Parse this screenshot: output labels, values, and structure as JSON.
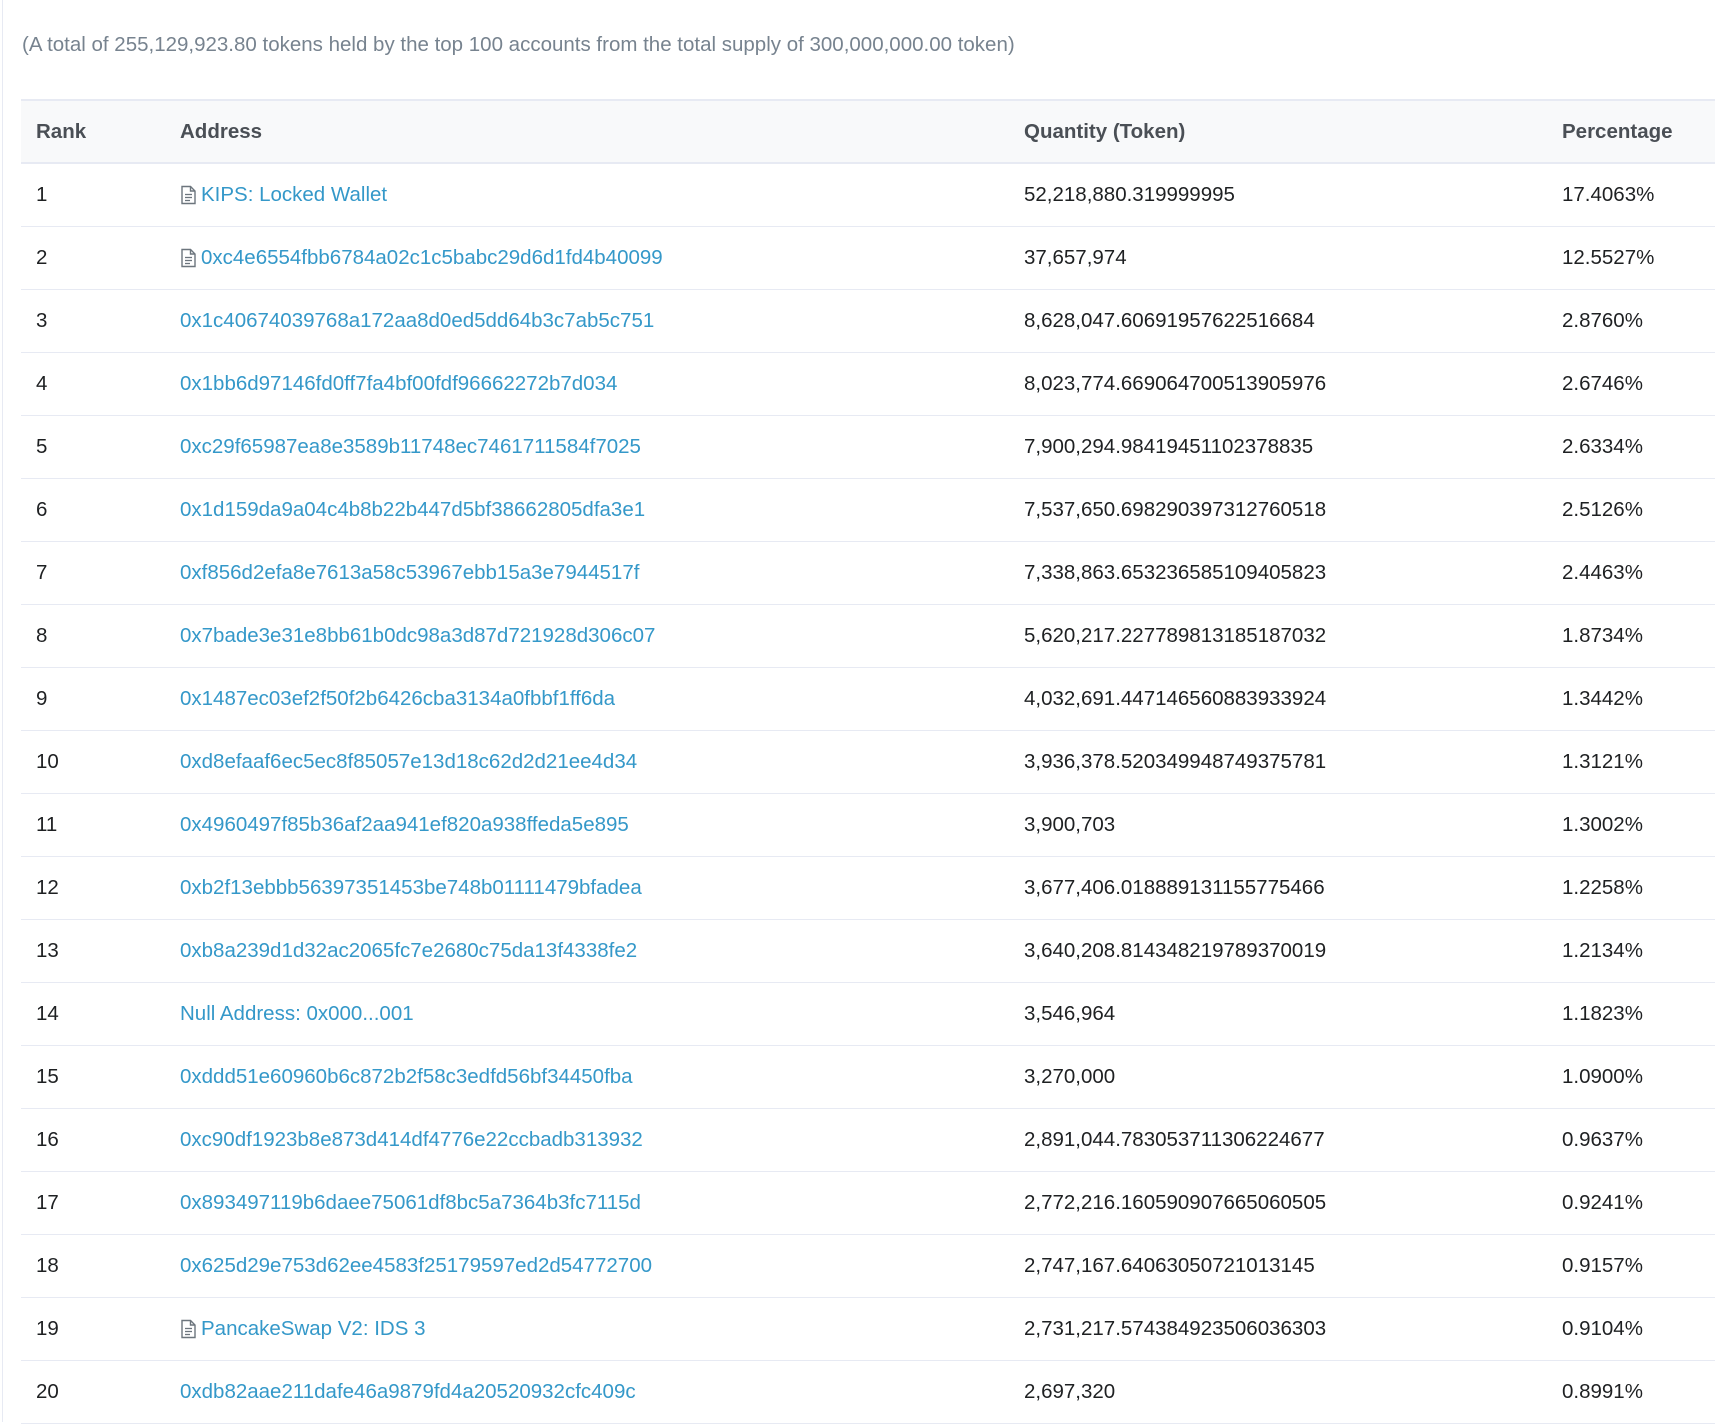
{
  "summary": "(A total of 255,129,923.80 tokens held by the top 100 accounts from the total supply of 300,000,000.00 token)",
  "table": {
    "headers": {
      "rank": "Rank",
      "address": "Address",
      "quantity": "Quantity (Token)",
      "percentage": "Percentage"
    },
    "icon": "contract-document-icon",
    "link_color": "#3498c9",
    "rows": [
      {
        "rank": "1",
        "address": "KIPS: Locked Wallet",
        "contract": true,
        "quantity": "52,218,880.319999995",
        "percentage": "17.4063%"
      },
      {
        "rank": "2",
        "address": "0xc4e6554fbb6784a02c1c5babc29d6d1fd4b40099",
        "contract": true,
        "quantity": "37,657,974",
        "percentage": "12.5527%"
      },
      {
        "rank": "3",
        "address": "0x1c40674039768a172aa8d0ed5dd64b3c7ab5c751",
        "contract": false,
        "quantity": "8,628,047.60691957622516684",
        "percentage": "2.8760%"
      },
      {
        "rank": "4",
        "address": "0x1bb6d97146fd0ff7fa4bf00fdf96662272b7d034",
        "contract": false,
        "quantity": "8,023,774.669064700513905976",
        "percentage": "2.6746%"
      },
      {
        "rank": "5",
        "address": "0xc29f65987ea8e3589b11748ec7461711584f7025",
        "contract": false,
        "quantity": "7,900,294.98419451102378835",
        "percentage": "2.6334%"
      },
      {
        "rank": "6",
        "address": "0x1d159da9a04c4b8b22b447d5bf38662805dfa3e1",
        "contract": false,
        "quantity": "7,537,650.698290397312760518",
        "percentage": "2.5126%"
      },
      {
        "rank": "7",
        "address": "0xf856d2efa8e7613a58c53967ebb15a3e7944517f",
        "contract": false,
        "quantity": "7,338,863.653236585109405823",
        "percentage": "2.4463%"
      },
      {
        "rank": "8",
        "address": "0x7bade3e31e8bb61b0dc98a3d87d721928d306c07",
        "contract": false,
        "quantity": "5,620,217.227789813185187032",
        "percentage": "1.8734%"
      },
      {
        "rank": "9",
        "address": "0x1487ec03ef2f50f2b6426cba3134a0fbbf1ff6da",
        "contract": false,
        "quantity": "4,032,691.447146560883933924",
        "percentage": "1.3442%"
      },
      {
        "rank": "10",
        "address": "0xd8efaaf6ec5ec8f85057e13d18c62d2d21ee4d34",
        "contract": false,
        "quantity": "3,936,378.520349948749375781",
        "percentage": "1.3121%"
      },
      {
        "rank": "11",
        "address": "0x4960497f85b36af2aa941ef820a938ffeda5e895",
        "contract": false,
        "quantity": "3,900,703",
        "percentage": "1.3002%"
      },
      {
        "rank": "12",
        "address": "0xb2f13ebbb56397351453be748b01111479bfadea",
        "contract": false,
        "quantity": "3,677,406.018889131155775466",
        "percentage": "1.2258%"
      },
      {
        "rank": "13",
        "address": "0xb8a239d1d32ac2065fc7e2680c75da13f4338fe2",
        "contract": false,
        "quantity": "3,640,208.814348219789370019",
        "percentage": "1.2134%"
      },
      {
        "rank": "14",
        "address": "Null Address: 0x000...001",
        "contract": false,
        "quantity": "3,546,964",
        "percentage": "1.1823%"
      },
      {
        "rank": "15",
        "address": "0xddd51e60960b6c872b2f58c3edfd56bf34450fba",
        "contract": false,
        "quantity": "3,270,000",
        "percentage": "1.0900%"
      },
      {
        "rank": "16",
        "address": "0xc90df1923b8e873d414df4776e22ccbadb313932",
        "contract": false,
        "quantity": "2,891,044.783053711306224677",
        "percentage": "0.9637%"
      },
      {
        "rank": "17",
        "address": "0x893497119b6daee75061df8bc5a7364b3fc7115d",
        "contract": false,
        "quantity": "2,772,216.160590907665060505",
        "percentage": "0.9241%"
      },
      {
        "rank": "18",
        "address": "0x625d29e753d62ee4583f25179597ed2d54772700",
        "contract": false,
        "quantity": "2,747,167.64063050721013145",
        "percentage": "0.9157%"
      },
      {
        "rank": "19",
        "address": "PancakeSwap V2: IDS 3",
        "contract": true,
        "quantity": "2,731,217.574384923506036303",
        "percentage": "0.9104%"
      },
      {
        "rank": "20",
        "address": "0xdb82aae211dafe46a9879fd4a20520932cfc409c",
        "contract": false,
        "quantity": "2,697,320",
        "percentage": "0.8991%"
      }
    ]
  }
}
